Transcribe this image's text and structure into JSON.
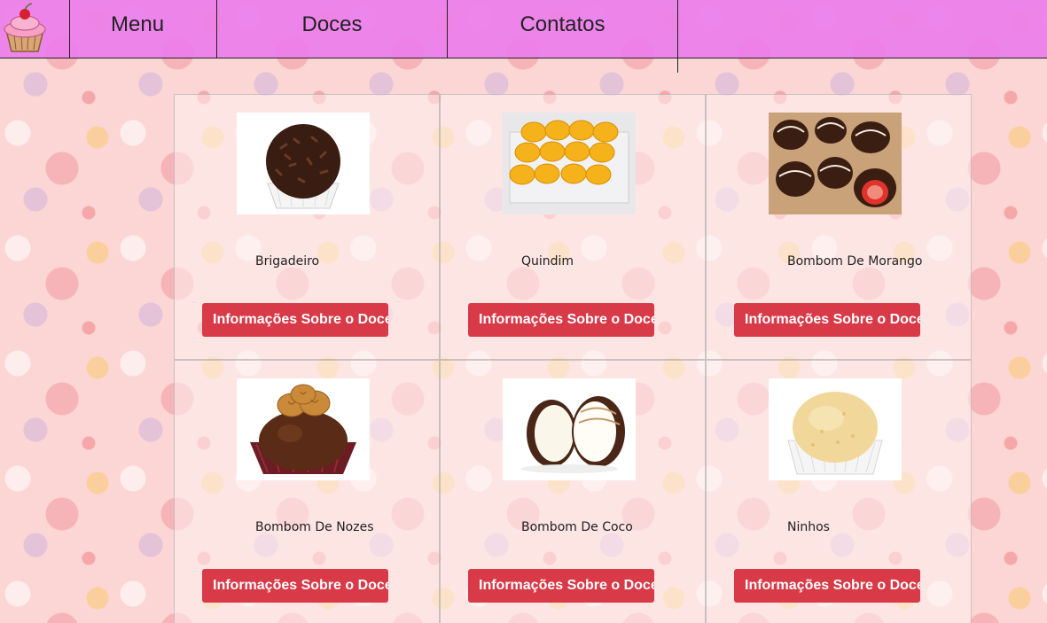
{
  "nav": {
    "logo_icon": "cupcake-icon",
    "items": [
      {
        "label": "Menu"
      },
      {
        "label": "Doces"
      },
      {
        "label": "Contatos"
      }
    ]
  },
  "products": [
    {
      "name": "Brigadeiro",
      "button": "Informações Sobre o Doce",
      "image": "brigadeiro-image"
    },
    {
      "name": "Quindim",
      "button": "Informações Sobre o Doce",
      "image": "quindim-image"
    },
    {
      "name": "Bombom De Morango",
      "button": "Informações Sobre o Doce",
      "image": "bombom-morango-image"
    },
    {
      "name": "Bombom De Nozes",
      "button": "Informações Sobre o Doce",
      "image": "bombom-nozes-image"
    },
    {
      "name": "Bombom De Coco",
      "button": "Informações Sobre o Doce",
      "image": "bombom-coco-image"
    },
    {
      "name": "Ninhos",
      "button": "Informações Sobre o Doce",
      "image": "ninhos-image"
    }
  ],
  "colors": {
    "navbar": "#eb7deb",
    "button": "#d93a48",
    "background": "#fbd6d4"
  }
}
